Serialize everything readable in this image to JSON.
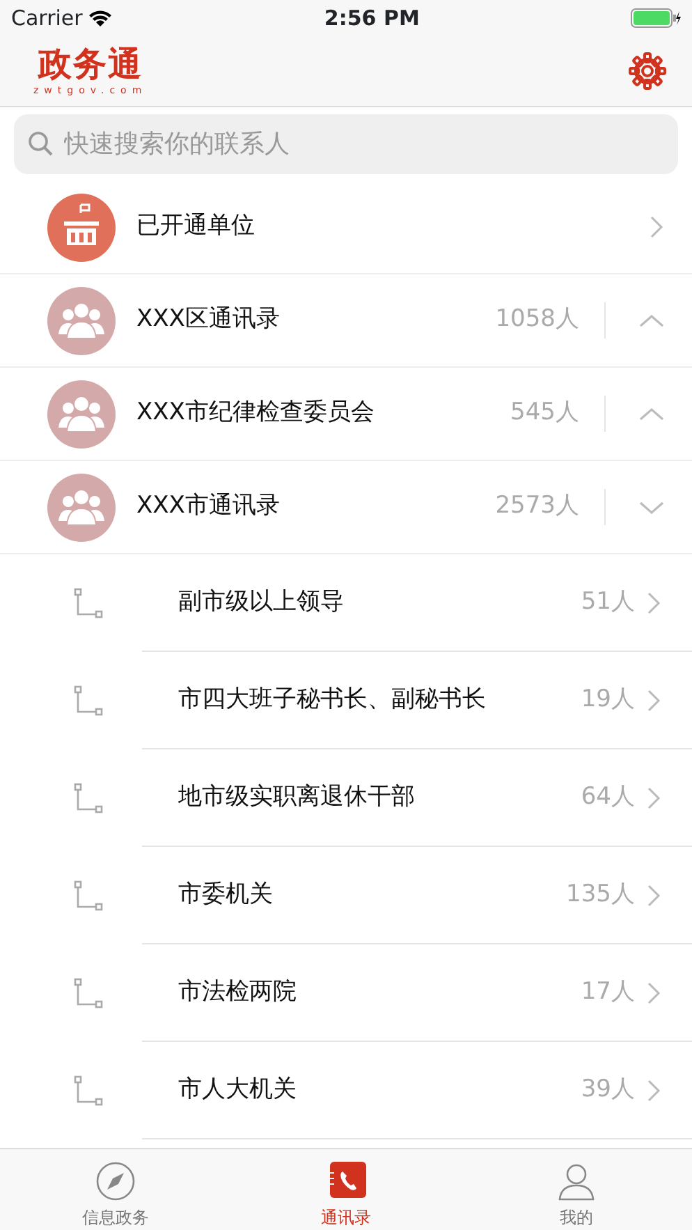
{
  "status_bar": {
    "carrier": "Carrier",
    "time": "2:56 PM"
  },
  "header": {
    "logo_title": "政务通",
    "logo_subtitle": "zwtgov.com"
  },
  "search": {
    "placeholder": "快速搜索你的联系人"
  },
  "units_row": {
    "label": "已开通单位"
  },
  "groups": [
    {
      "name": "XXX区通讯录",
      "count": "1058人",
      "expanded": false
    },
    {
      "name": "XXX市纪律检查委员会",
      "count": "545人",
      "expanded": false
    },
    {
      "name": "XXX市通讯录",
      "count": "2573人",
      "expanded": true,
      "children": [
        {
          "name": "副市级以上领导",
          "count": "51人"
        },
        {
          "name": "市四大班子秘书长、副秘书长",
          "count": "19人"
        },
        {
          "name": "地市级实职离退休干部",
          "count": "64人"
        },
        {
          "name": "市委机关",
          "count": "135人"
        },
        {
          "name": "市法检两院",
          "count": "17人"
        },
        {
          "name": "市人大机关",
          "count": "39人"
        }
      ]
    }
  ],
  "tab_bar": [
    {
      "label": "信息政务",
      "kind": "compass",
      "selected": false
    },
    {
      "label": "通讯录",
      "kind": "contacts",
      "selected": true
    },
    {
      "label": "我的",
      "kind": "person",
      "selected": false
    }
  ]
}
